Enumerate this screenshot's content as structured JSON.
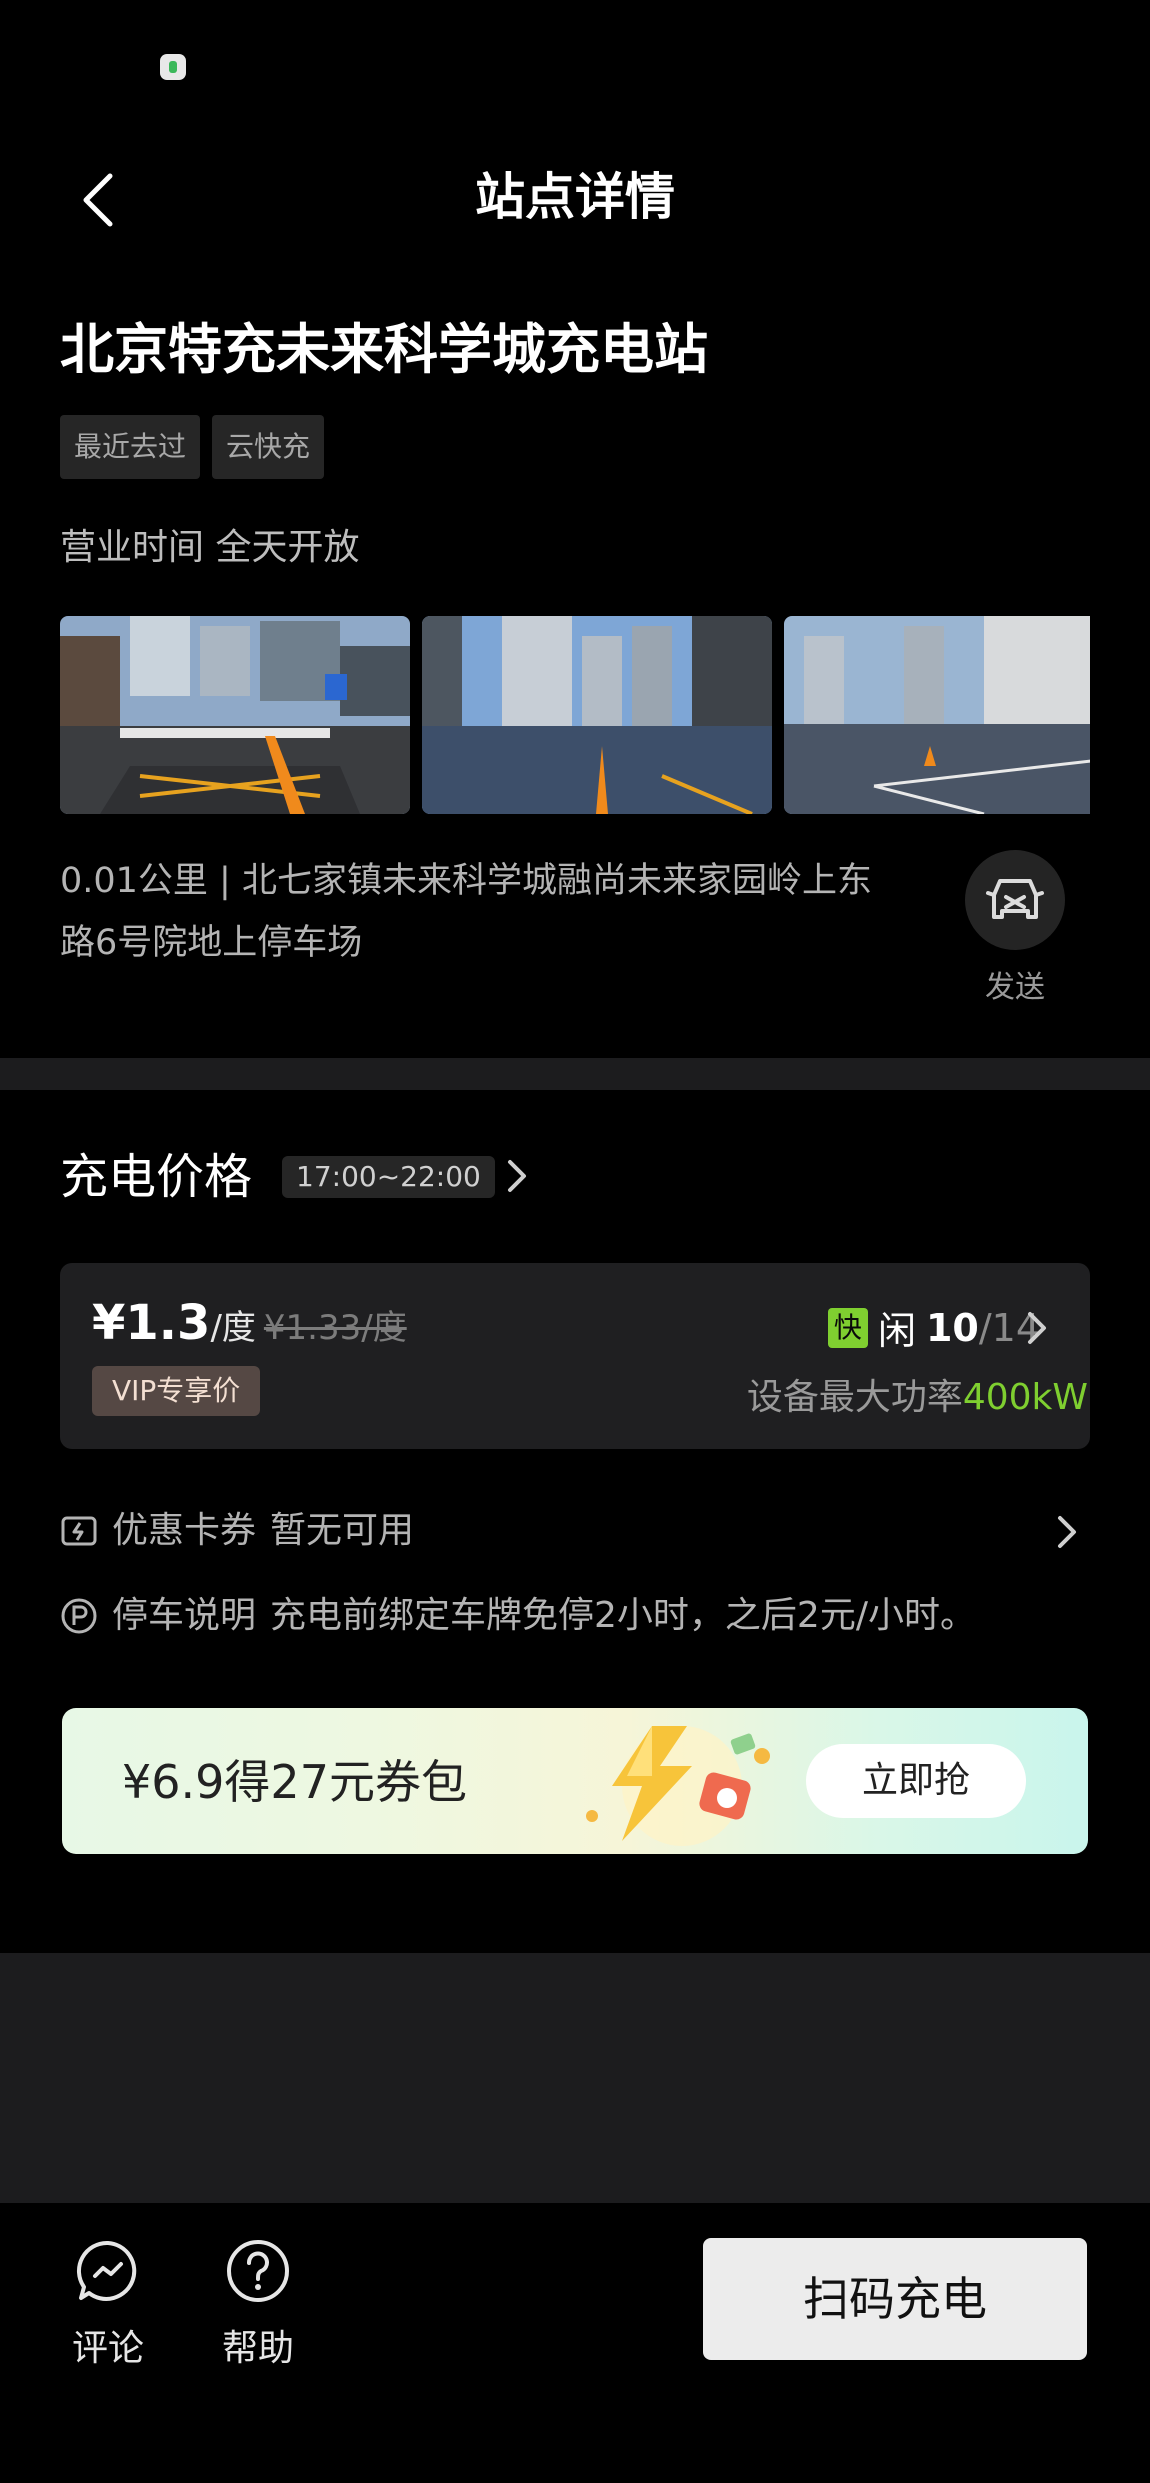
{
  "header": {
    "title": "站点详情"
  },
  "station": {
    "name": "北京特充未来科学城充电站",
    "tags": [
      "最近去过",
      "云快充"
    ],
    "hours": "营业时间 全天开放",
    "address": "0.01公里 | 北七家镇未来科学城融尚未来家园岭上东路6号院地上停车场",
    "send_label": "发送"
  },
  "pricing": {
    "title": "充电价格",
    "time_range": "17:00~22:00",
    "price": "¥1.3",
    "unit": "/度",
    "original_price": "¥1.33/度",
    "vip_label": "VIP专享价",
    "fast_label": "快",
    "idle_label": "闲",
    "idle_count": "10",
    "total_count": "/14",
    "power_label": "设备最大功率",
    "power_value": "400kW"
  },
  "coupon": {
    "label": "优惠卡券",
    "value": "暂无可用"
  },
  "parking": {
    "label": "停车说明",
    "value": "充电前绑定车牌免停2小时，之后2元/小时。"
  },
  "promo": {
    "text": "¥6.9得27元券包",
    "button": "立即抢"
  },
  "bottom_bar": {
    "comment_label": "评论",
    "help_label": "帮助",
    "scan_button": "扫码充电"
  },
  "colors": {
    "accent_green": "#7fcf30",
    "background": "#000000",
    "panel": "#1f1f21"
  }
}
